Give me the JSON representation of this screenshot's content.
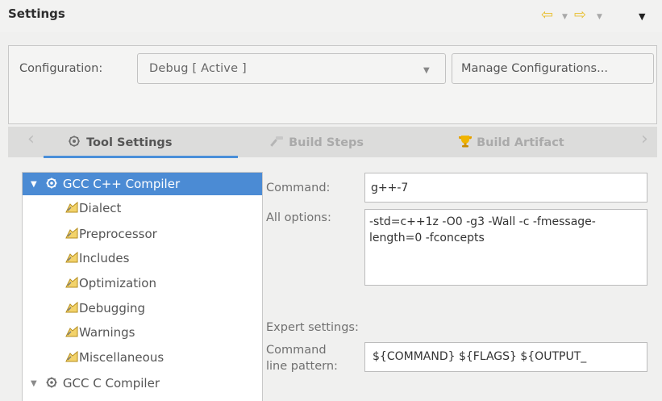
{
  "header": {
    "title": "Settings",
    "back_glyph": "⇦",
    "forward_glyph": "⇨",
    "caret_glyph": "▼",
    "menu_glyph": "▼"
  },
  "config": {
    "label": "Configuration:",
    "selected": "Debug  [ Active ]",
    "manage_label": "Manage Configurations..."
  },
  "tabs": [
    {
      "label": "Tool Settings",
      "icon": "gear-wrench-icon",
      "active": true
    },
    {
      "label": "Build Steps",
      "icon": "hammer-icon",
      "active": false
    },
    {
      "label": "Build Artifact",
      "icon": "trophy-icon",
      "active": false
    }
  ],
  "tree": {
    "items": [
      {
        "label": "GCC C++ Compiler",
        "icon": "gear-icon",
        "selected": true,
        "expanded": true
      },
      {
        "label": "Dialect",
        "icon": "tool-settings-icon"
      },
      {
        "label": "Preprocessor",
        "icon": "tool-settings-icon"
      },
      {
        "label": "Includes",
        "icon": "tool-settings-icon"
      },
      {
        "label": "Optimization",
        "icon": "tool-settings-icon"
      },
      {
        "label": "Debugging",
        "icon": "tool-settings-icon"
      },
      {
        "label": "Warnings",
        "icon": "tool-settings-icon"
      },
      {
        "label": "Miscellaneous",
        "icon": "tool-settings-icon"
      },
      {
        "label": "GCC C Compiler",
        "icon": "gear-icon",
        "expanded": true
      }
    ]
  },
  "panel": {
    "command_label": "Command:",
    "command_value": "g++-7",
    "all_options_label": "All options:",
    "all_options_value": "-std=c++1z -O0 -g3 -Wall -c -fmessage-length=0 -fconcepts",
    "expert_label": "Expert settings:",
    "pattern_label_line1": "Command",
    "pattern_label_line2": "line pattern:",
    "pattern_value": "${COMMAND} ${FLAGS} ${OUTPUT_"
  },
  "colors": {
    "selection": "#4b8bd4",
    "tab_underline": "#4a8fd9",
    "nav_arrow": "#e8bf2f"
  }
}
